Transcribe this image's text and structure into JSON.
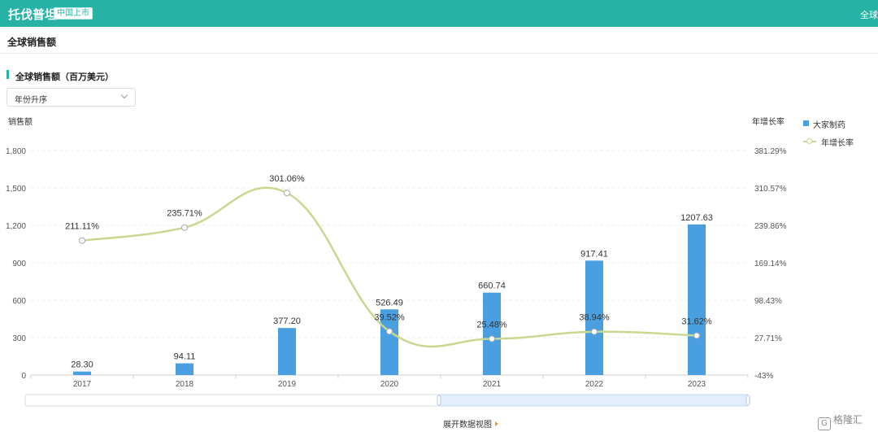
{
  "header": {
    "title": "托伐普坦",
    "badge": "中国上市",
    "right_text": "全球"
  },
  "subheader": {
    "title": "全球销售额"
  },
  "section": {
    "title": "全球销售额（百万美元）"
  },
  "sort_select": {
    "value": "年份升序"
  },
  "legend": {
    "bar_series": "大家制药",
    "line_series": "年增长率"
  },
  "footer": {
    "expand_label": "展开数据视图"
  },
  "watermark": {
    "text": "格隆汇"
  },
  "colors": {
    "accent": "#26b3a6",
    "bar": "#4a9fe0",
    "line": "#c9d891",
    "expand_arrow": "#f39a2b"
  },
  "chart_data": {
    "type": "bar",
    "categories": [
      "2017",
      "2018",
      "2019",
      "2020",
      "2021",
      "2022",
      "2023"
    ],
    "ylabel": "销售额",
    "y2label": "年增长率",
    "ylim": [
      0,
      1800
    ],
    "yticks": [
      "0",
      "300",
      "600",
      "900",
      "1,200",
      "1,500",
      "1,800"
    ],
    "y2lim": [
      -43,
      381.29
    ],
    "y2ticks": [
      "-43%",
      "27.71%",
      "98.43%",
      "169.14%",
      "239.86%",
      "310.57%",
      "381.29%"
    ],
    "series": [
      {
        "name": "大家制药",
        "type": "bar",
        "values": [
          28.3,
          94.11,
          377.2,
          526.49,
          660.74,
          917.41,
          1207.63
        ],
        "labels": [
          "28.30",
          "94.11",
          "377.20",
          "526.49",
          "660.74",
          "917.41",
          "1207.63"
        ]
      },
      {
        "name": "年增长率",
        "type": "line",
        "axis": "right",
        "values": [
          211.11,
          235.71,
          301.06,
          39.52,
          25.48,
          38.94,
          31.62
        ],
        "labels": [
          "211.11%",
          "235.71%",
          "301.06%",
          "39.52%",
          "25.48%",
          "38.94%",
          "31.62%"
        ]
      }
    ],
    "grid": true,
    "legend_position": "right"
  }
}
